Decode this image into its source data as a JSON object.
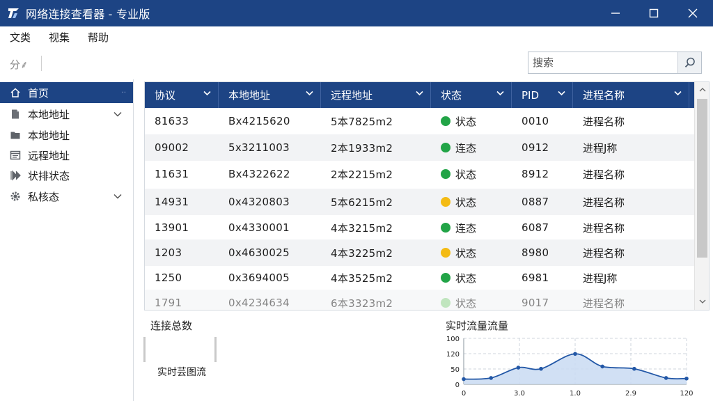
{
  "window": {
    "title": "网络连接查看器 - 专业版",
    "controls": [
      "minimize",
      "maximize",
      "close"
    ]
  },
  "menu": [
    "文类",
    "视集",
    "帮助"
  ],
  "toolbar": {
    "label": "分⸙"
  },
  "search": {
    "placeholder": "搜索",
    "value": ""
  },
  "sidebar": {
    "items": [
      {
        "label": "首页",
        "icon": "home-icon",
        "active": true,
        "chevron": false
      },
      {
        "label": "本地地址",
        "icon": "file-icon",
        "active": false,
        "chevron": true
      },
      {
        "label": "本地地址",
        "icon": "folder-icon",
        "active": false,
        "chevron": false
      },
      {
        "label": "远程地址",
        "icon": "window-icon",
        "active": false,
        "chevron": false
      },
      {
        "label": "状排状态",
        "icon": "forward-icon",
        "active": false,
        "chevron": false
      },
      {
        "label": "私核态",
        "icon": "gear-icon",
        "active": false,
        "chevron": true
      }
    ]
  },
  "table": {
    "columns": [
      "协议",
      "本地地址",
      "远程地址",
      "状态",
      "PID",
      "进程名称"
    ],
    "rows": [
      {
        "protocol": "81633",
        "local": "Bx4215620",
        "remote": "5本7825m2",
        "state": "状态",
        "state_color": "#22a447",
        "pid": "0010",
        "process": "进程名称"
      },
      {
        "protocol": "09002",
        "local": "5x3211003",
        "remote": "2本1933m2",
        "state": "连态",
        "state_color": "#22a447",
        "pid": "0912",
        "process": "进程J称"
      },
      {
        "protocol": "11631",
        "local": "Bx4322622",
        "remote": "2本2215m2",
        "state": "状态",
        "state_color": "#22a447",
        "pid": "8912",
        "process": "进程名称"
      },
      {
        "protocol": "14931",
        "local": "0x4320803",
        "remote": "5本6215m2",
        "state": "状态",
        "state_color": "#f4bb14",
        "pid": "0887",
        "process": "进程名称"
      },
      {
        "protocol": "13901",
        "local": "0x4330001",
        "remote": "4本3215m2",
        "state": "连态",
        "state_color": "#22a447",
        "pid": "6087",
        "process": "进程名称"
      },
      {
        "protocol": "1203",
        "local": "0x4630025",
        "remote": "4本3225m2",
        "state": "状态",
        "state_color": "#f4bb14",
        "pid": "8980",
        "process": "进程名称"
      },
      {
        "protocol": "1250",
        "local": "0x3694005",
        "remote": "4本3525m2",
        "state": "状态",
        "state_color": "#22a447",
        "pid": "6981",
        "process": "进程J称"
      },
      {
        "protocol": "1791",
        "local": "0x4234634",
        "remote": "6本3323m2",
        "state": "状态",
        "state_color": "#8ed18a",
        "pid": "9017",
        "process": "进程名称"
      }
    ]
  },
  "panels": {
    "connections_title": "连接总数",
    "connections_caption": "实时芸图流",
    "traffic_title": "实时流量流量"
  },
  "colors": {
    "accent": "#1d4484",
    "ok": "#22a447",
    "warn": "#f4bb14",
    "line": "#2257a6",
    "area": "#c9dbf2"
  },
  "chart_data": {
    "type": "area",
    "title": "实时流量流量",
    "xlabel": "",
    "ylabel": "",
    "x_ticks": [
      "0",
      "3.0",
      "1.0",
      "2.9",
      "120"
    ],
    "y_ticks": [
      "0",
      "50",
      "120",
      "100"
    ],
    "ylim": [
      0,
      4
    ],
    "grid": true,
    "series": [
      {
        "points": [
          [
            0.0,
            0.45
          ],
          [
            0.6,
            0.55
          ],
          [
            1.2,
            1.45
          ],
          [
            1.7,
            1.35
          ],
          [
            2.45,
            2.65
          ],
          [
            3.05,
            1.55
          ],
          [
            3.75,
            1.35
          ],
          [
            4.45,
            0.55
          ],
          [
            4.9,
            0.5
          ]
        ]
      }
    ],
    "xlim": [
      0,
      4.9
    ]
  }
}
